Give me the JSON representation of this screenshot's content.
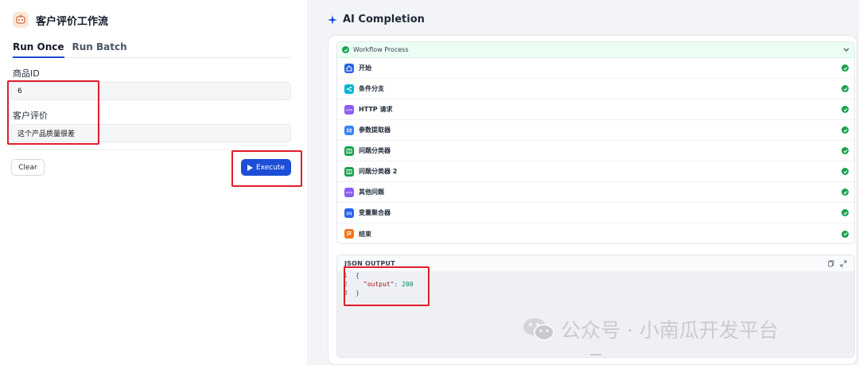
{
  "left": {
    "app_title": "客户评价工作流",
    "tabs": [
      {
        "label": "Run Once",
        "active": true
      },
      {
        "label": "Run Batch",
        "active": false
      }
    ],
    "fields": [
      {
        "label": "商品ID",
        "value": "6"
      },
      {
        "label": "客户评价",
        "value": "这个产品质量很差"
      }
    ],
    "clear_label": "Clear",
    "execute_label": "Execute",
    "accent_color": "#1d4ed8"
  },
  "right": {
    "title": "AI Completion",
    "workflow": {
      "header": "Workflow Process",
      "status_color": "#16a34a",
      "nodes": [
        {
          "name": "开始",
          "icon": "home-icon",
          "color": "#2563eb"
        },
        {
          "name": "条件分支",
          "icon": "branch-icon",
          "color": "#06b6d4"
        },
        {
          "name": "HTTP 请求",
          "icon": "http-icon",
          "color": "#8b5cf6"
        },
        {
          "name": "参数提取器",
          "icon": "extractor-icon",
          "color": "#3b82f6"
        },
        {
          "name": "问题分类器",
          "icon": "classifier-icon",
          "color": "#16a34a"
        },
        {
          "name": "问题分类器 2",
          "icon": "classifier-icon",
          "color": "#16a34a"
        },
        {
          "name": "其他问题",
          "icon": "http-icon",
          "color": "#8b5cf6"
        },
        {
          "name": "变量聚合器",
          "icon": "aggregator-icon",
          "color": "#2563eb"
        },
        {
          "name": "结束",
          "icon": "end-icon",
          "color": "#f97316"
        }
      ]
    },
    "json_output": {
      "label": "JSON OUTPUT",
      "line_numbers": [
        "1",
        "2",
        "3"
      ],
      "open_brace": "{",
      "key": "\"output\"",
      "colon": ": ",
      "value": "200",
      "close_brace": "}"
    }
  },
  "watermark": "公众号 · 小南瓜开发平台"
}
